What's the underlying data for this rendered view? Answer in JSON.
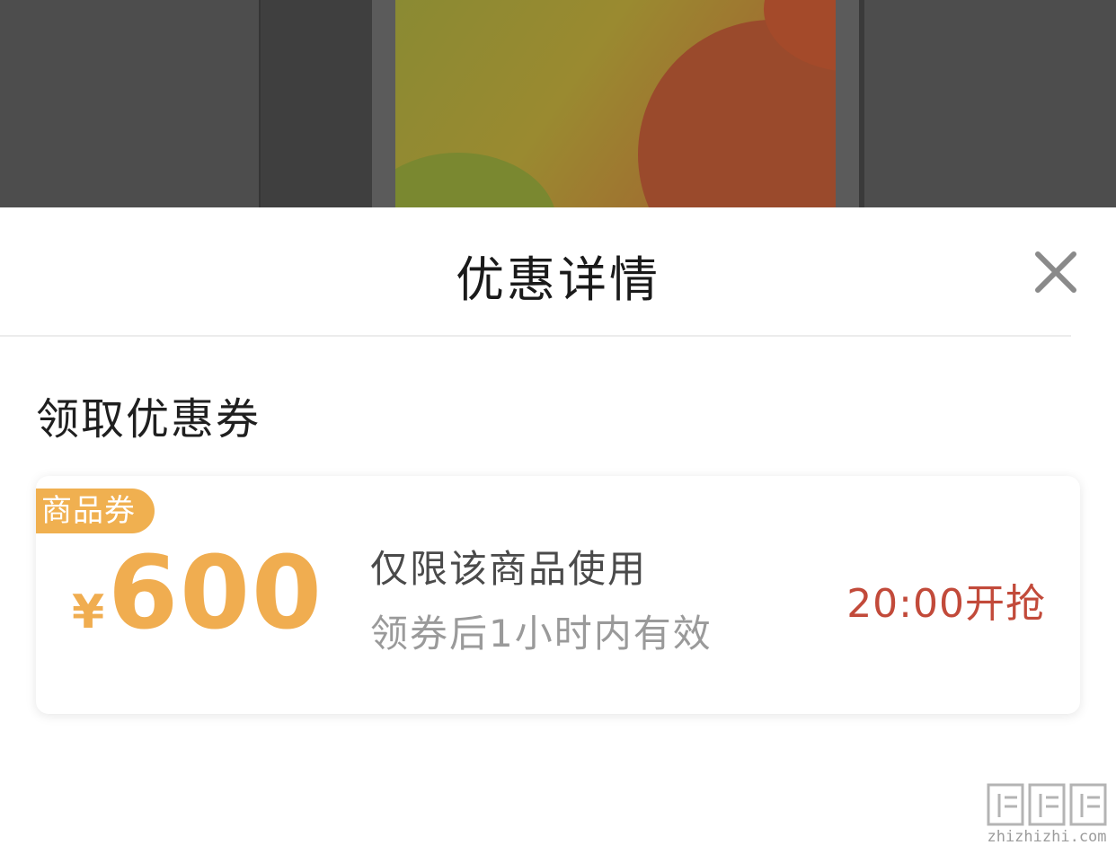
{
  "sheet": {
    "title": "优惠详情",
    "close_icon": "close-icon",
    "section_title": "领取优惠券"
  },
  "coupon": {
    "tag": "商品券",
    "currency": "¥",
    "amount": "600",
    "description": "仅限该商品使用",
    "validity": "领券后1小时内有效",
    "action": "20:00开抢"
  },
  "colors": {
    "accent_orange": "#F0AD50",
    "action_red": "#C24A3A",
    "backdrop": "#4D4D4D"
  },
  "watermark": {
    "logo_text": "值值值",
    "url": "zhizhizhi.com"
  }
}
